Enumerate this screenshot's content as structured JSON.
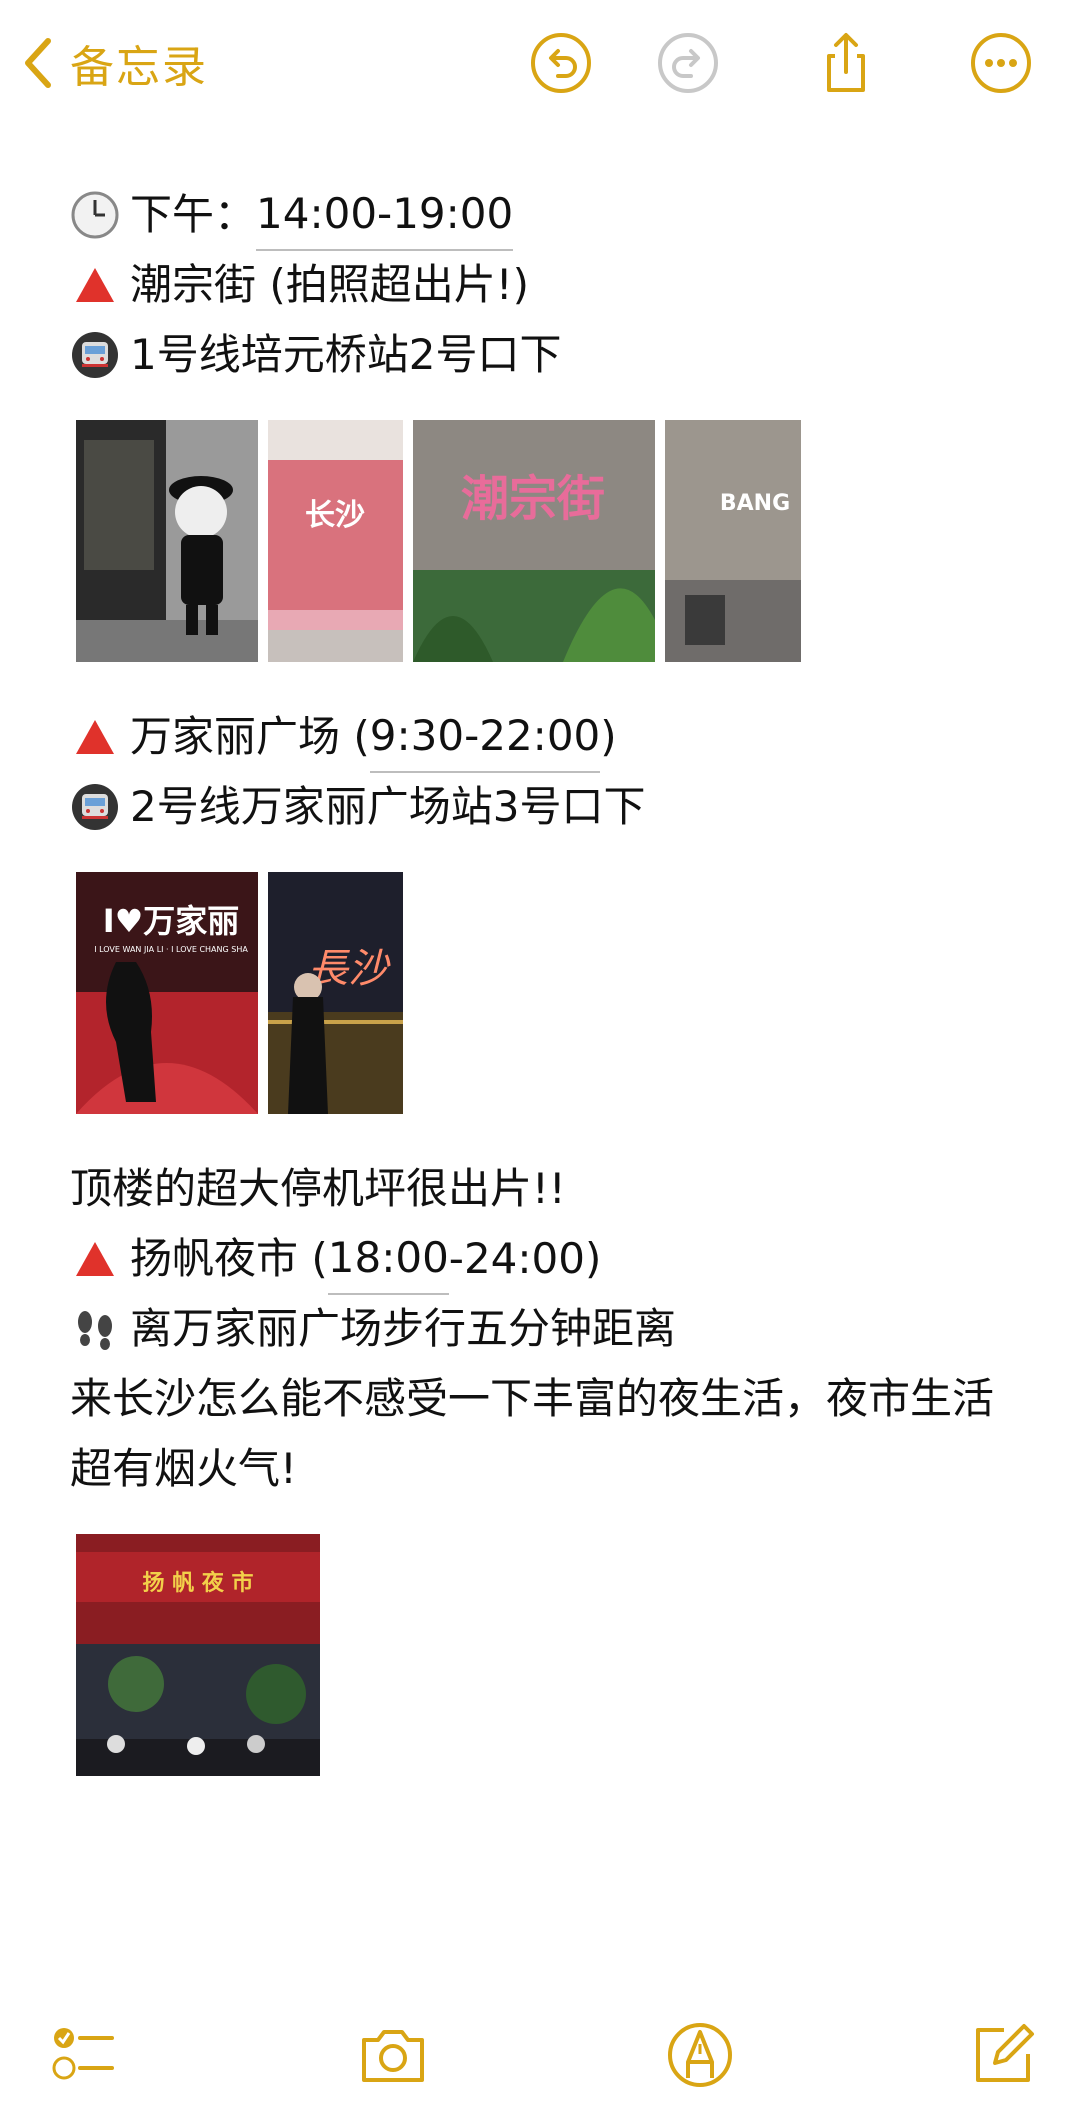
{
  "toolbar": {
    "back_label": "备忘录",
    "accent": "#d9a514"
  },
  "note": {
    "section1": {
      "time_prefix": "下午：",
      "time_value": "14:00-19:00",
      "place": "潮宗街 (拍照超出片!)",
      "metro": "1号线培元桥站2号口下",
      "photos": [
        "changsha-street-doll",
        "pink-changsha-wall",
        "chaozongjie-sign-wall",
        "bang-building"
      ]
    },
    "section2": {
      "place_prefix": "万家丽广场 (",
      "place_time": "9:30-22:00",
      "place_suffix": ")",
      "metro": "2号线万家丽广场站3号口下",
      "photos": [
        "wanjiali-rooftop-red-sign",
        "changsha-neon-night"
      ],
      "caption": "顶楼的超大停机坪很出片!!"
    },
    "section3": {
      "place_prefix": "扬帆夜市 (",
      "place_time_a": "18:00",
      "place_time_b": "-24:00)",
      "walk": "离万家丽广场步行五分钟距离",
      "desc": "来长沙怎么能不感受一下丰富的夜生活，夜市生活超有烟火气!",
      "photos": [
        "yangfan-night-market-gate"
      ]
    }
  },
  "photo_text": {
    "changsha": "长沙",
    "chaozongjie": "潮宗街",
    "bang": "BANG",
    "wanjiali": "I♥万家丽",
    "wanjiali_sub": "I LOVE WAN JIA LI · I LOVE CHANG SHA",
    "neon": "長沙",
    "market": "扬 帆 夜 市"
  }
}
